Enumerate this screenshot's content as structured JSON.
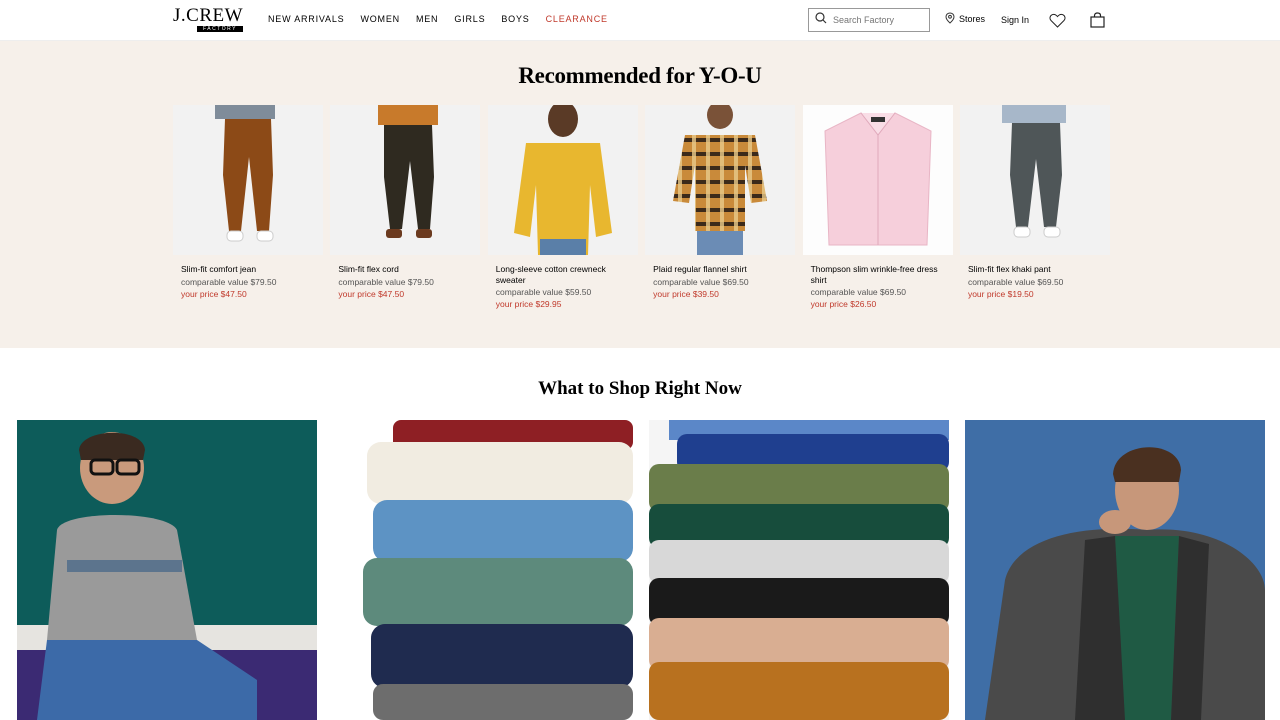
{
  "header": {
    "logo_text": "J.CREW",
    "logo_sub": "FACTORY",
    "nav": [
      {
        "label": "NEW ARRIVALS",
        "sale": false
      },
      {
        "label": "WOMEN",
        "sale": false
      },
      {
        "label": "MEN",
        "sale": false
      },
      {
        "label": "GIRLS",
        "sale": false
      },
      {
        "label": "BOYS",
        "sale": false
      },
      {
        "label": "CLEARANCE",
        "sale": true
      }
    ],
    "search_placeholder": "Search Factory",
    "stores_label": "Stores",
    "signin_label": "Sign In"
  },
  "recommended": {
    "title": "Recommended for Y-O-U",
    "products": [
      {
        "name": "Slim-fit comfort jean",
        "comparable": "comparable value $79.50",
        "price": "your price $47.50",
        "image": "brown-pants"
      },
      {
        "name": "Slim-fit flex cord",
        "comparable": "comparable value $79.50",
        "price": "your price $47.50",
        "image": "dark-pants"
      },
      {
        "name": "Long-sleeve cotton crewneck sweater",
        "comparable": "comparable value $59.50",
        "price": "your price $29.95",
        "image": "yellow-sweater"
      },
      {
        "name": "Plaid regular flannel shirt",
        "comparable": "comparable value $69.50",
        "price": "your price $39.50",
        "image": "plaid-shirt"
      },
      {
        "name": "Thompson slim wrinkle-free dress shirt",
        "comparable": "comparable value $69.50",
        "price": "your price $26.50",
        "image": "pink-shirt"
      },
      {
        "name": "Slim-fit flex khaki pant",
        "comparable": "comparable value $69.50",
        "price": "your price $19.50",
        "image": "grey-pants"
      }
    ]
  },
  "shop_now": {
    "title": "What to Shop Right Now",
    "tiles": [
      {
        "image": "man-grey-sweater"
      },
      {
        "image": "folded-polos"
      },
      {
        "image": "folded-sweaters"
      },
      {
        "image": "man-grey-coat"
      }
    ]
  },
  "colors": {
    "sale_red": "#c0392b",
    "rec_bg": "#f6f0ea"
  }
}
